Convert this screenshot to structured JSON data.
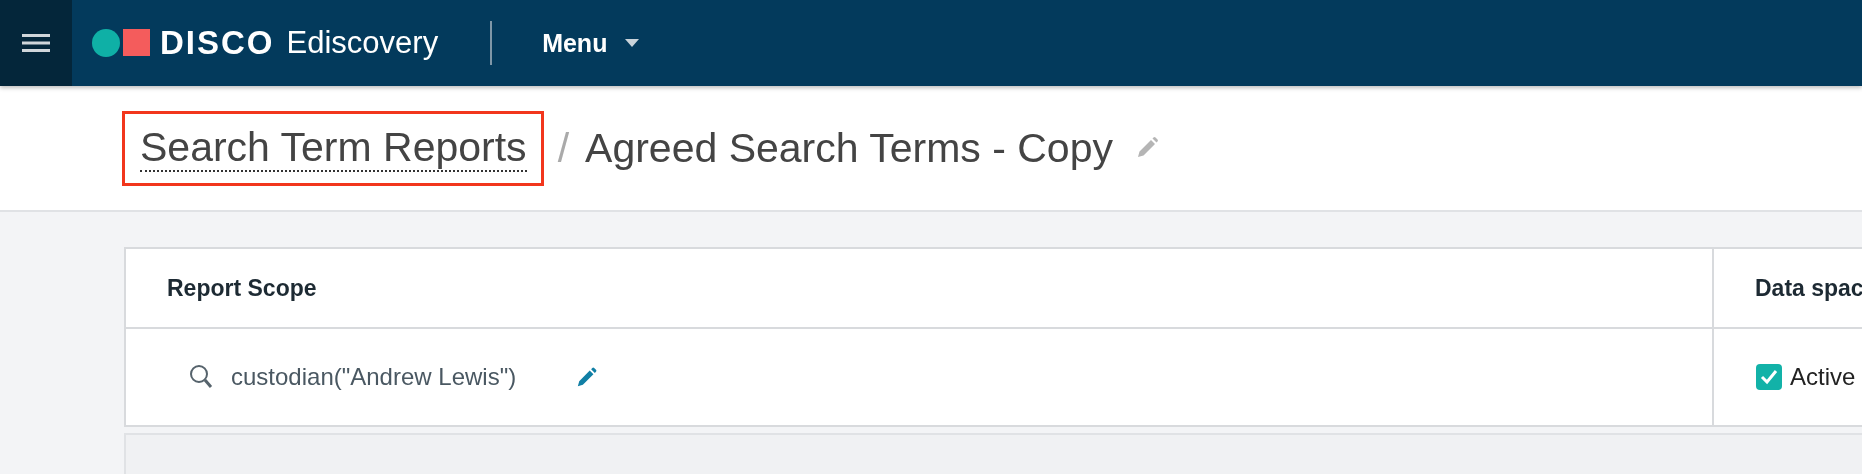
{
  "navbar": {
    "brand": "DISCO",
    "product": "Ediscovery",
    "menu": "Menu"
  },
  "breadcrumb": {
    "parent": "Search Term Reports",
    "parent_highlighted": true,
    "separator": "/",
    "current": "Agreed Search Terms - Copy"
  },
  "table": {
    "columns": [
      "Report Scope",
      "Data spac"
    ],
    "rows": [
      {
        "scope": "custodian(\"Andrew Lewis\")",
        "status": "Active",
        "checked": true
      }
    ]
  }
}
